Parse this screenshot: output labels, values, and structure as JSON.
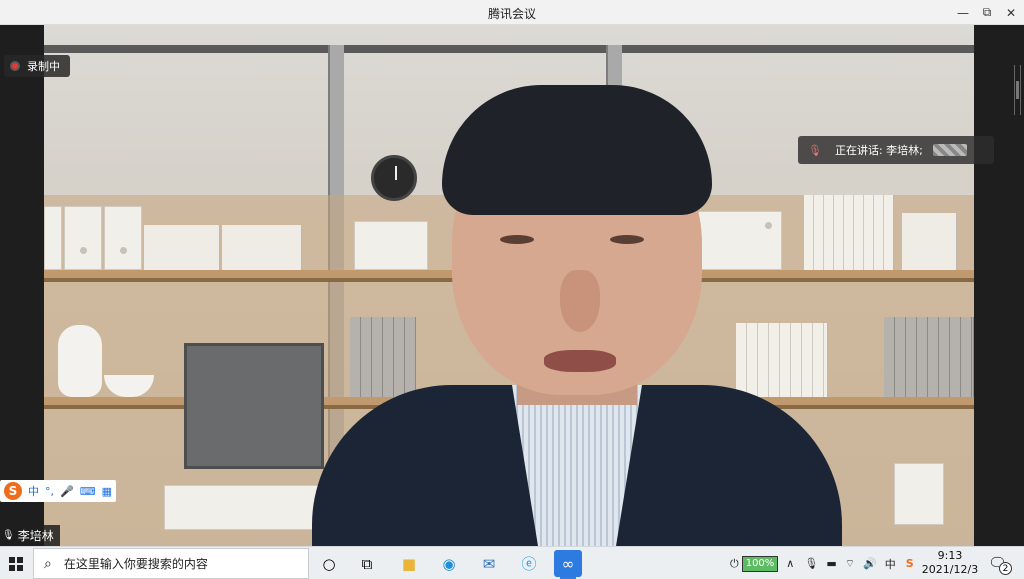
{
  "window": {
    "title": "腾讯会议",
    "controls": {
      "minimize": "—",
      "restore": "⧉",
      "close": "✕"
    }
  },
  "meeting": {
    "recording_label": "录制中",
    "speaking_label": "正在讲话: 李培林;",
    "participant_name": "李培林"
  },
  "ime": {
    "logo": "S",
    "mode": "中",
    "punct": "°,",
    "mic": "🎤",
    "keyboard": "⌨",
    "grid": "▦"
  },
  "taskbar": {
    "search_placeholder": "在这里输入你要搜索的内容",
    "icons": [
      "cortana-icon",
      "task-view-icon",
      "file-explorer-icon",
      "edge-icon",
      "mail-icon",
      "ie-icon",
      "tencent-meeting-icon"
    ],
    "battery": "100%",
    "time": "9:13",
    "date": "2021/12/3",
    "notification_count": "2",
    "tray_ime": "中"
  },
  "colors": {
    "record": "#e53935",
    "accent": "#3a7bd5",
    "sogou": "#f06b1a"
  }
}
